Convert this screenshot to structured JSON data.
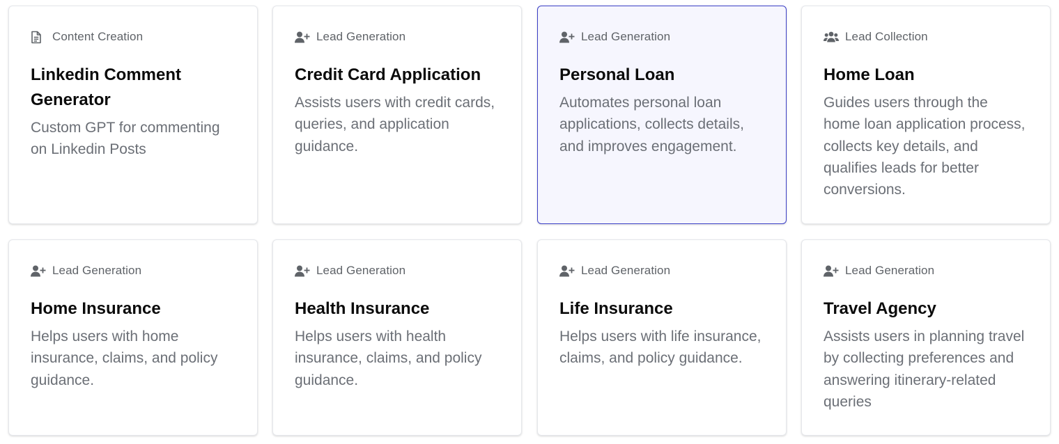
{
  "cards": [
    {
      "category": "Content Creation",
      "icon": "document-icon",
      "title": "Linkedin Comment Generator",
      "description": "Custom GPT for commenting on Linkedin Posts"
    },
    {
      "category": "Lead Generation",
      "icon": "user-plus-icon",
      "title": "Credit Card Application",
      "description": "Assists users with credit cards, queries, and application guidance."
    },
    {
      "category": "Lead Generation",
      "icon": "user-plus-icon",
      "title": "Personal Loan",
      "description": "Automates personal loan applications, collects details, and improves engagement.",
      "selected": true
    },
    {
      "category": "Lead Collection",
      "icon": "users-group-icon",
      "title": "Home Loan",
      "description": "Guides users through the home loan application process, collects key details, and qualifies leads for better conversions."
    },
    {
      "category": "Lead Generation",
      "icon": "user-plus-icon",
      "title": "Home Insurance",
      "description": "Helps users with home insurance, claims, and policy guidance."
    },
    {
      "category": "Lead Generation",
      "icon": "user-plus-icon",
      "title": "Health Insurance",
      "description": "Helps users with health insurance, claims, and policy guidance."
    },
    {
      "category": "Lead Generation",
      "icon": "user-plus-icon",
      "title": "Life Insurance",
      "description": "Helps users with life insurance, claims, and policy guidance."
    },
    {
      "category": "Lead Generation",
      "icon": "user-plus-icon",
      "title": "Travel Agency",
      "description": "Assists users in planning travel by collecting preferences and answering itinerary-related queries"
    }
  ],
  "colors": {
    "selected_border": "#3b3fc7",
    "selected_bg": "#f6f6fe",
    "icon": "#5f6368"
  }
}
